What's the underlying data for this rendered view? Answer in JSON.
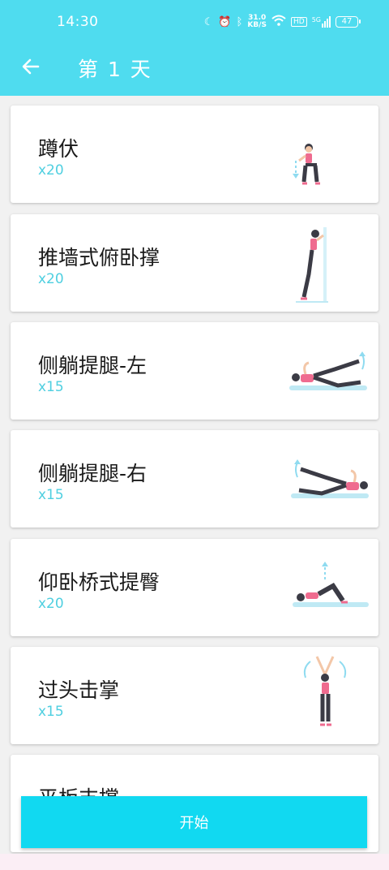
{
  "status": {
    "time": "14:30",
    "net_speed_value": "31.0",
    "net_speed_unit": "KB/S",
    "hd_label": "HD",
    "signal_label": "5G",
    "battery": "47"
  },
  "header": {
    "title": "第 1 天"
  },
  "exercises": [
    {
      "name": "蹲伏",
      "reps": "x20"
    },
    {
      "name": "推墙式俯卧撑",
      "reps": "x20"
    },
    {
      "name": "侧躺提腿-左",
      "reps": "x15"
    },
    {
      "name": "侧躺提腿-右",
      "reps": "x15"
    },
    {
      "name": "仰卧桥式提臀",
      "reps": "x20"
    },
    {
      "name": "过头击掌",
      "reps": "x15"
    },
    {
      "name": "平板支撑",
      "reps": ""
    }
  ],
  "footer": {
    "start_label": "开始"
  },
  "colors": {
    "accent": "#4fdcef",
    "button": "#11d9f1",
    "reps_text": "#4fcfe0",
    "figure_pink": "#ef6b8f",
    "figure_dark": "#3b3b45",
    "mat_blue": "#bfe9f4"
  }
}
